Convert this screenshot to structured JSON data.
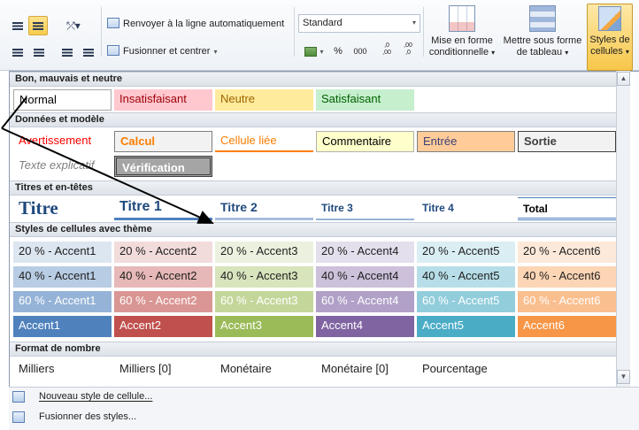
{
  "ribbon": {
    "wrap_text": "Renvoyer à la ligne automatiquement",
    "merge_center": "Fusionner et centrer",
    "number_format": "Standard",
    "percent": "%",
    "thousands": "000",
    "decimal_increase": ",0 ,00",
    "decimal_decrease": ",00 ,0",
    "conditional_format": [
      "Mise en forme",
      "conditionnelle"
    ],
    "format_as_table": [
      "Mettre sous forme",
      "de tableau"
    ],
    "cell_styles": [
      "Styles de",
      "cellules"
    ]
  },
  "gallery": {
    "sections": [
      "Bon, mauvais et neutre",
      "Données et modèle",
      "Titres et en-têtes",
      "Styles de cellules avec thème",
      "Format de nombre"
    ],
    "good_bad": [
      "Normal",
      "Insatisfaisant",
      "Neutre",
      "Satisfaisant"
    ],
    "data_model_row1": [
      "Avertissement",
      "Calcul",
      "Cellule liée",
      "Commentaire",
      "Entrée",
      "Sortie"
    ],
    "data_model_row2": [
      "Texte explicatif",
      "Vérification"
    ],
    "titles": [
      "Titre",
      "Titre 1",
      "Titre 2",
      "Titre 3",
      "Titre 4",
      "Total"
    ],
    "accent20": [
      "20 % - Accent1",
      "20 % - Accent2",
      "20 % - Accent3",
      "20 % - Accent4",
      "20 % - Accent5",
      "20 % - Accent6"
    ],
    "accent40": [
      "40 % - Accent1",
      "40 % - Accent2",
      "40 % - Accent3",
      "40 % - Accent4",
      "40 % - Accent5",
      "40 % - Accent6"
    ],
    "accent60": [
      "60 % - Accent1",
      "60 % - Accent2",
      "60 % - Accent3",
      "60 % - Accent4",
      "60 % - Accent5",
      "60 % - Accent6"
    ],
    "accent100": [
      "Accent1",
      "Accent2",
      "Accent3",
      "Accent4",
      "Accent5",
      "Accent6"
    ],
    "number_formats": [
      "Milliers",
      "Milliers [0]",
      "Monétaire",
      "Monétaire [0]",
      "Pourcentage"
    ]
  },
  "menu": {
    "new_style": "Nouveau style de cellule...",
    "merge_styles": "Fusionner des styles..."
  },
  "colors": {
    "accent1": "#4f81bd",
    "accent2": "#c0504d",
    "accent3": "#9bbb59",
    "accent4": "#8064a2",
    "accent5": "#4bacc6",
    "accent6": "#f79646"
  }
}
